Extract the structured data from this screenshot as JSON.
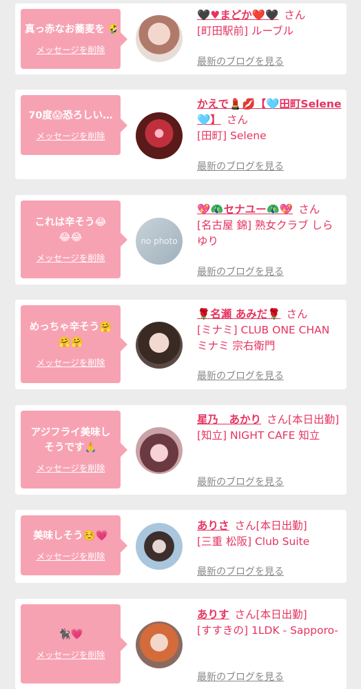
{
  "entries": [
    {
      "message": "真っ赤なお蕎麦を\n🤣w",
      "delete_label": "メッセージを削除",
      "name": "🖤♥まどか❤️🖤",
      "suffix": "さん",
      "shop": "[町田駅前] ルーブル",
      "blog_label": "最新のブログを見る"
    },
    {
      "message": "70度😱恐ろしい…",
      "delete_label": "メッセージを削除",
      "name": "かえで💄💋【🩵田町Selene🩵】",
      "suffix": "さん",
      "shop": "[田町] Selene",
      "blog_label": "最新のブログを見る"
    },
    {
      "message": "これは辛そう😂\n😂😂",
      "delete_label": "メッセージを削除",
      "name": "💖🦚セナユー🦚💖",
      "suffix": "さん",
      "shop": "[名古屋 錦] 熟女クラブ しらゆり",
      "blog_label": "最新のブログを見る",
      "avatar_text": "no photo"
    },
    {
      "message": "めっちゃ辛そう🤗\n🤗🤗",
      "delete_label": "メッセージを削除",
      "name": "🌹名瀬 あみだ🌹",
      "suffix": "さん",
      "shop": "[ミナミ] CLUB ONE CHAN ミナミ 宗右衛門",
      "blog_label": "最新のブログを見る"
    },
    {
      "message": "アジフライ美味し\nそうです🙏",
      "delete_label": "メッセージを削除",
      "name": "星乃　あかり",
      "suffix": "さん[本日出勤]",
      "shop": "[知立] NIGHT CAFE 知立",
      "blog_label": "最新のブログを見る"
    },
    {
      "message": "美味しそう☺️💗",
      "delete_label": "メッセージを削除",
      "name": "ありさ",
      "suffix": "さん[本日出勤]",
      "shop": "[三重 松阪] Club Suite",
      "blog_label": "最新のブログを見る"
    },
    {
      "message": "🐈‍⬛💗",
      "delete_label": "メッセージを削除",
      "name": "ありす",
      "suffix": "さん[本日出勤]",
      "shop": "[すすきの] 1LDK - Sapporo-",
      "blog_label": "最新のブログを見る"
    }
  ],
  "colors": {
    "accent": "#e6335f",
    "bubble": "#f7a2b3",
    "background": "#ececec",
    "link_gray": "#888888"
  }
}
